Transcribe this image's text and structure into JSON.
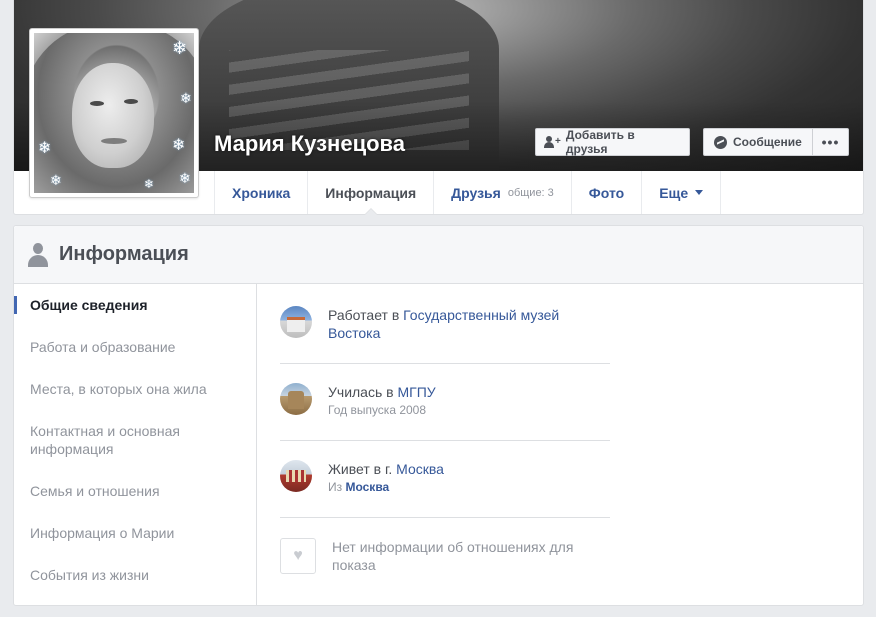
{
  "profile": {
    "name": "Мария Кузнецова",
    "add_friend_label": "Добавить в друзья",
    "message_label": "Сообщение",
    "more_label": "•••"
  },
  "nav": {
    "tabs": [
      {
        "label": "Хроника"
      },
      {
        "label": "Информация"
      },
      {
        "label": "Друзья",
        "count": "общие: 3"
      },
      {
        "label": "Фото"
      },
      {
        "label": "Еще"
      }
    ]
  },
  "info": {
    "title": "Информация",
    "sidebar": [
      "Общие сведения",
      "Работа и образование",
      "Места, в которых она жила",
      "Контактная и основная информация",
      "Семья и отношения",
      "Информация о Марии",
      "События из жизни"
    ],
    "work": {
      "prefix": "Работает в ",
      "place": "Государственный музей Востока"
    },
    "education": {
      "prefix": "Училась в ",
      "place": "МГПУ",
      "sub": "Год выпуска 2008"
    },
    "lives": {
      "prefix": "Живет в г. ",
      "place": "Москва",
      "from_prefix": "Из ",
      "from_place": "Москва"
    },
    "relationship": {
      "text": "Нет информации об отношениях для показа"
    }
  },
  "colors": {
    "link": "#365899",
    "accent": "#4267b2",
    "muted": "#90949c",
    "background": "#e9ebee"
  }
}
